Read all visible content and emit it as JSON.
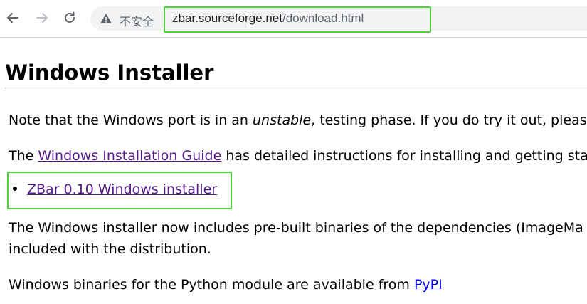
{
  "browser": {
    "back_icon": "back-arrow-icon",
    "forward_icon": "forward-arrow-icon",
    "reload_icon": "reload-icon",
    "security_icon": "warning-triangle-icon",
    "security_label": "不安全",
    "url_host": "zbar.sourceforge.net",
    "url_path": "/download.html",
    "highlight_color": "#4cd137"
  },
  "page": {
    "title": "Windows Installer",
    "p1_before": "Note that the Windows port is in an ",
    "p1_em": "unstable",
    "p1_after": ", testing phase. If you do try it out, pleas",
    "p2_before": "The ",
    "p2_link": "Windows Installation Guide",
    "p2_after": " has detailed instructions for installing and getting sta",
    "installer_link": "ZBar 0.10 Windows installer",
    "p3_line1": "The Windows installer now includes pre-built binaries of the dependencies (ImageMa",
    "p3_line2": "included with the distribution.",
    "p4_before": "Windows binaries for the Python module are available from ",
    "p4_link": "PyPI"
  }
}
